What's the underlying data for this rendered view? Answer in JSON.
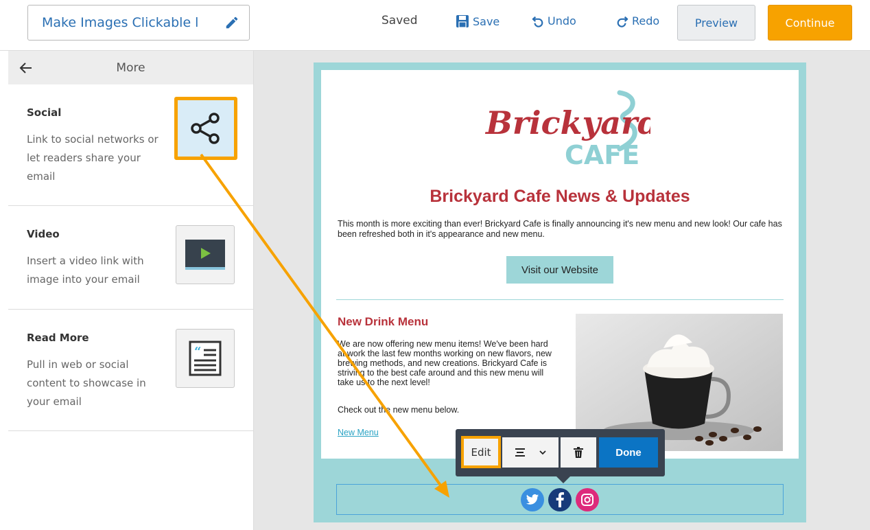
{
  "toolbar": {
    "title": "Make Images Clickable l",
    "status": "Saved",
    "save_label": "Save",
    "undo_label": "Undo",
    "redo_label": "Redo",
    "preview_label": "Preview",
    "continue_label": "Continue"
  },
  "sidebar": {
    "header": "More",
    "items": [
      {
        "title": "Social",
        "description": "Link to social networks or let readers share your email",
        "icon": "share-icon"
      },
      {
        "title": "Video",
        "description": "Insert a video link with image into your email",
        "icon": "video-icon"
      },
      {
        "title": "Read More",
        "description": "Pull in web or social content to showcase in your email",
        "icon": "article-icon"
      }
    ]
  },
  "email": {
    "logo_word1": "Brickyard",
    "logo_word2": "CAFE",
    "headline": "Brickyard Cafe News & Updates",
    "intro": "This month is more exciting than ever! Brickyard Cafe is finally announcing it's new menu and new look! Our cafe has been refreshed both in it's appearance and new menu.",
    "cta_label": "Visit our Website",
    "section_title": "New Drink Menu",
    "section_body": "We are now offering new menu items! We've been hard at work the last few months working on new flavors, new brewing methods, and new creations. Brickyard Cafe is striving to the best cafe around and this new menu will take us to the next level!",
    "section_body2": "Check out the new menu below.",
    "menu_link": "New Menu",
    "social_icons": [
      "twitter-icon",
      "facebook-icon",
      "instagram-icon"
    ]
  },
  "floating_toolbar": {
    "edit_label": "Edit",
    "done_label": "Done"
  },
  "colors": {
    "accent": "#f7a200",
    "link": "#2a6fb3",
    "brand_red": "#b8323b",
    "teal": "#9dd6d8",
    "done_blue": "#0b74c4"
  }
}
